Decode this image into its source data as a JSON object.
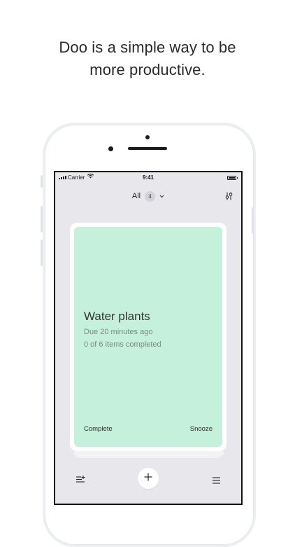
{
  "headline": {
    "line1": "Doo is a simple way to be",
    "line2": "more productive."
  },
  "status_bar": {
    "carrier": "Carrier",
    "time": "9:41",
    "icons": [
      "signal-icon",
      "wifi-icon",
      "battery-icon"
    ]
  },
  "filter": {
    "label": "All",
    "count": "4",
    "icons": [
      "chevron-down-icon",
      "sliders-icon"
    ]
  },
  "card": {
    "title": "Water plants",
    "due": "Due 20 minutes ago",
    "progress": "0 of 6 items completed",
    "complete_label": "Complete",
    "snooze_label": "Snooze",
    "color": "#c5f1dc"
  },
  "toolbar": {
    "icons": [
      "sort-icon",
      "plus-icon",
      "menu-icon"
    ]
  },
  "colors": {
    "screen_background": "#e8e7ec",
    "card_green": "#c5f1dc",
    "text_dark": "#2a2a2a",
    "text_muted": "#7a8a82"
  }
}
